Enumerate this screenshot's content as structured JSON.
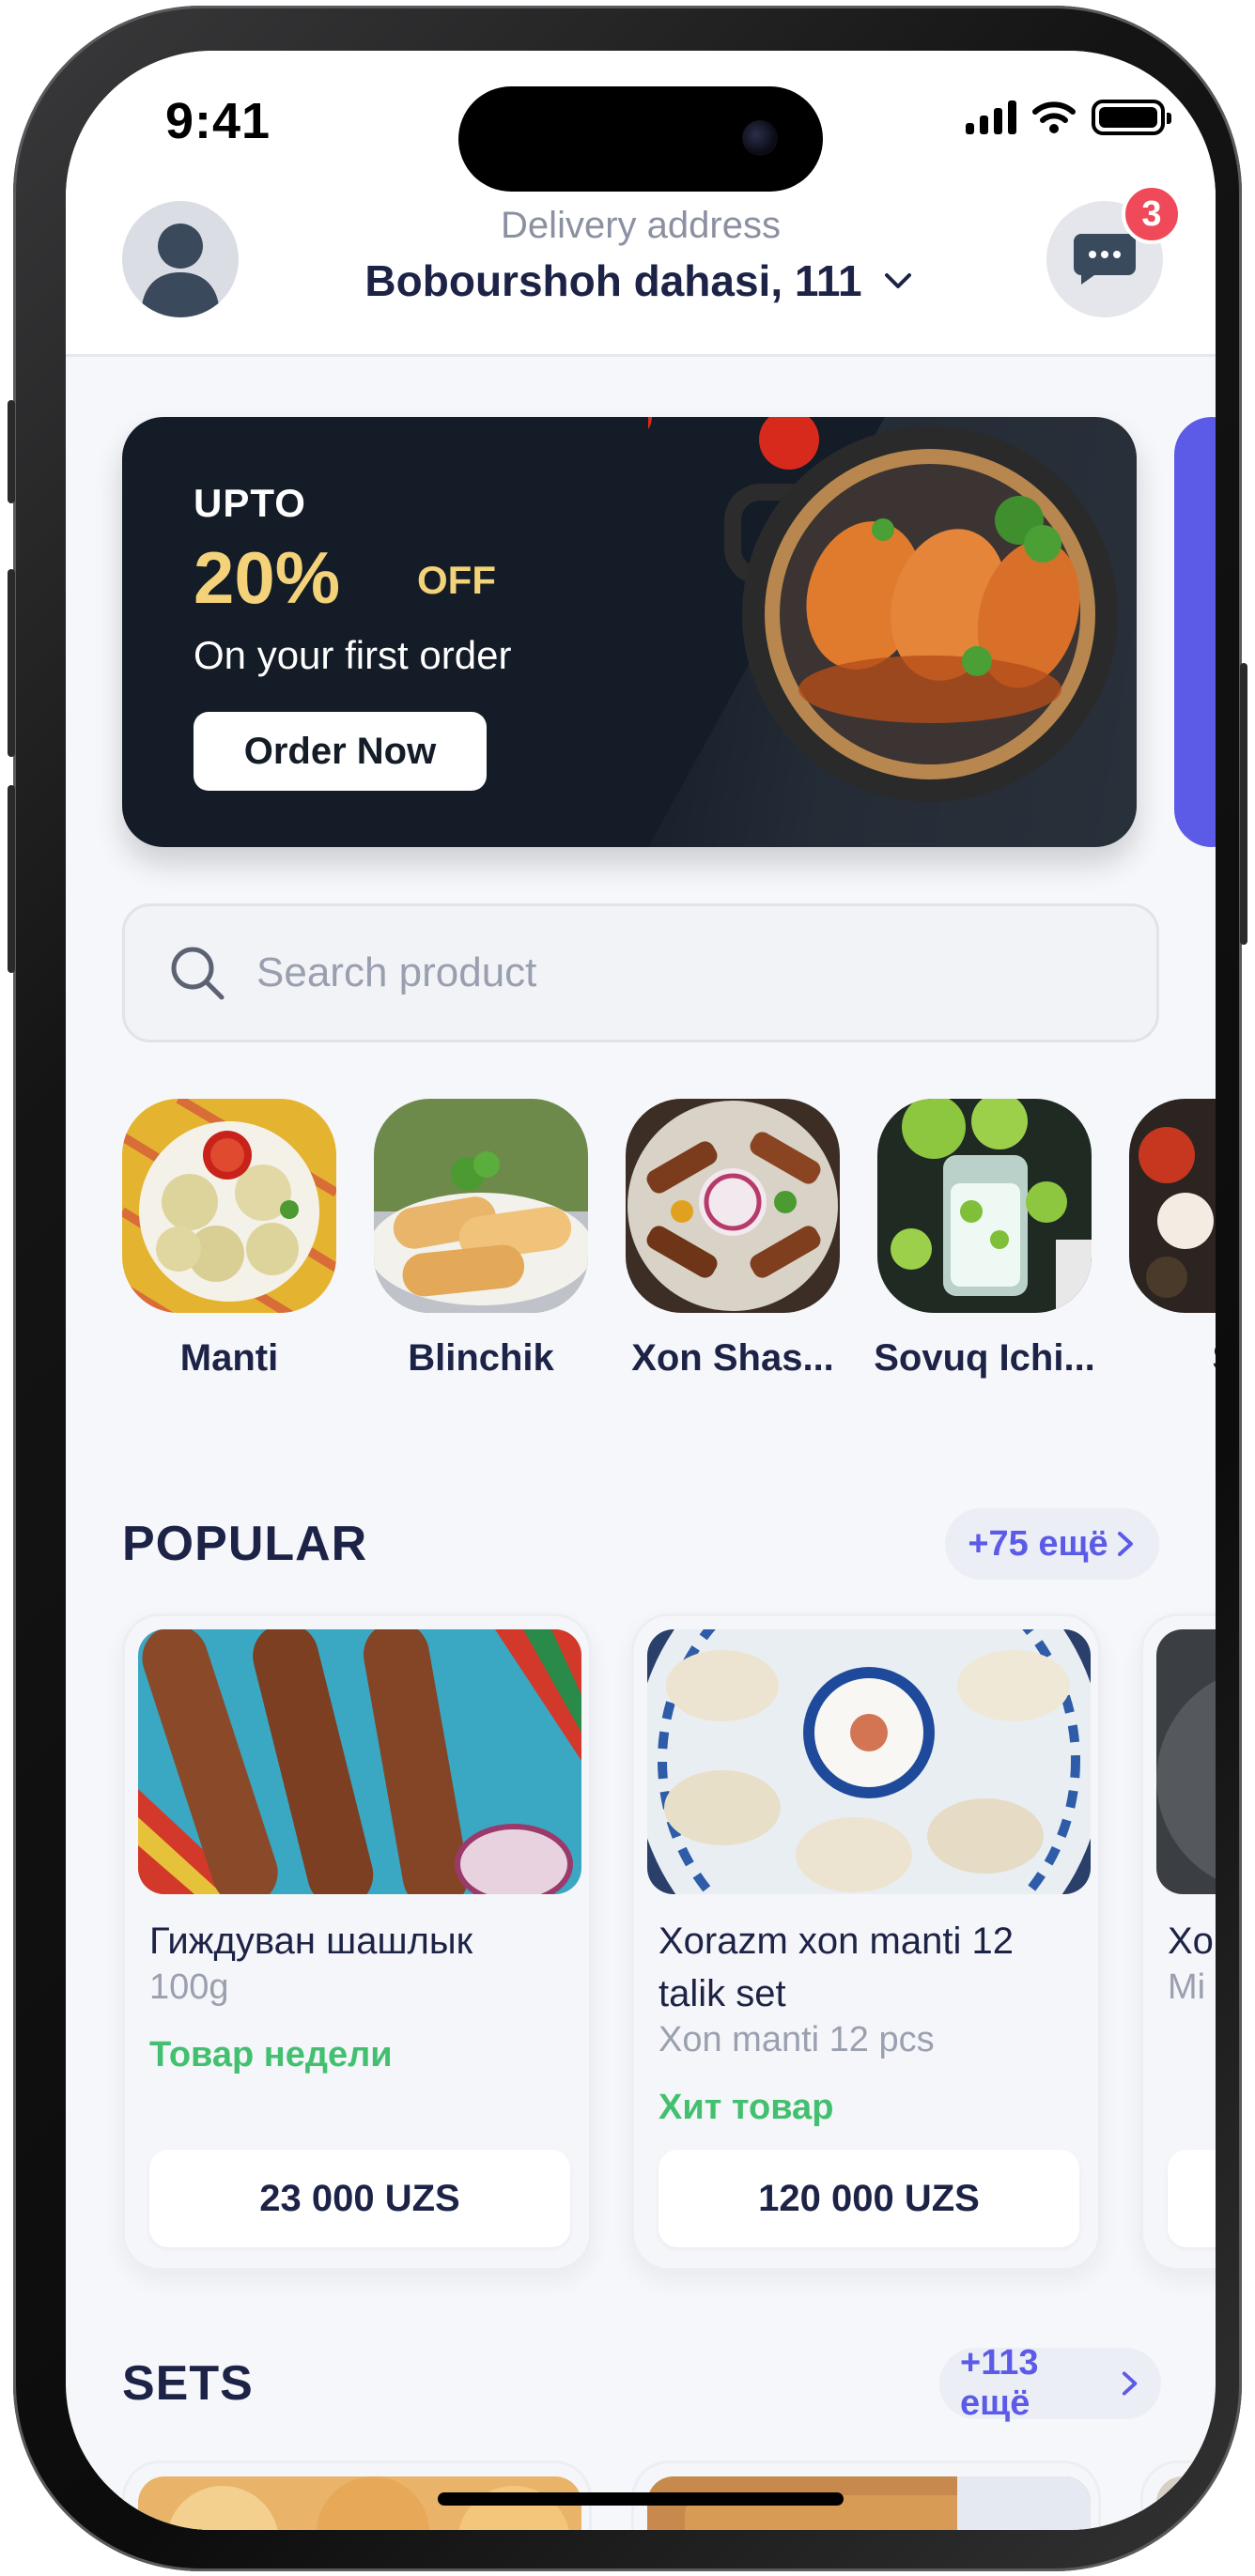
{
  "status": {
    "time": "9:41"
  },
  "header": {
    "address_label": "Delivery address",
    "address_value": "Bobourshoh dahasi, 111",
    "chat_badge": "3"
  },
  "banner": {
    "upto": "UPTO",
    "percent": "20%",
    "off": "OFF",
    "subtitle": "On your first order",
    "cta": "Order Now"
  },
  "search": {
    "placeholder": "Search product"
  },
  "categories": [
    {
      "label": "Manti"
    },
    {
      "label": "Blinchik"
    },
    {
      "label": "Xon Shas..."
    },
    {
      "label": "Sovuq Ichi..."
    },
    {
      "label": "So"
    }
  ],
  "popular": {
    "title": "POPULAR",
    "more": "+75 ещё",
    "items": [
      {
        "name": "Гиждуван шашлык",
        "weight": "100g",
        "tag": "Товар недели",
        "price": "23 000 UZS"
      },
      {
        "name": "Xorazm xon manti 12 talik set",
        "weight": "Xon manti 12 pcs",
        "tag": "Хит товар",
        "price": "120 000 UZS"
      },
      {
        "name": "Xo",
        "weight": "Mi",
        "tag": "",
        "price": ""
      }
    ]
  },
  "sets": {
    "title": "SETS",
    "more": "+113 ещё"
  },
  "colors": {
    "accent": "#5b5be8",
    "tag_green": "#43c06f",
    "badge_red": "#f04a5a",
    "banner_gold": "#f3d27a",
    "ink": "#1d2346"
  }
}
